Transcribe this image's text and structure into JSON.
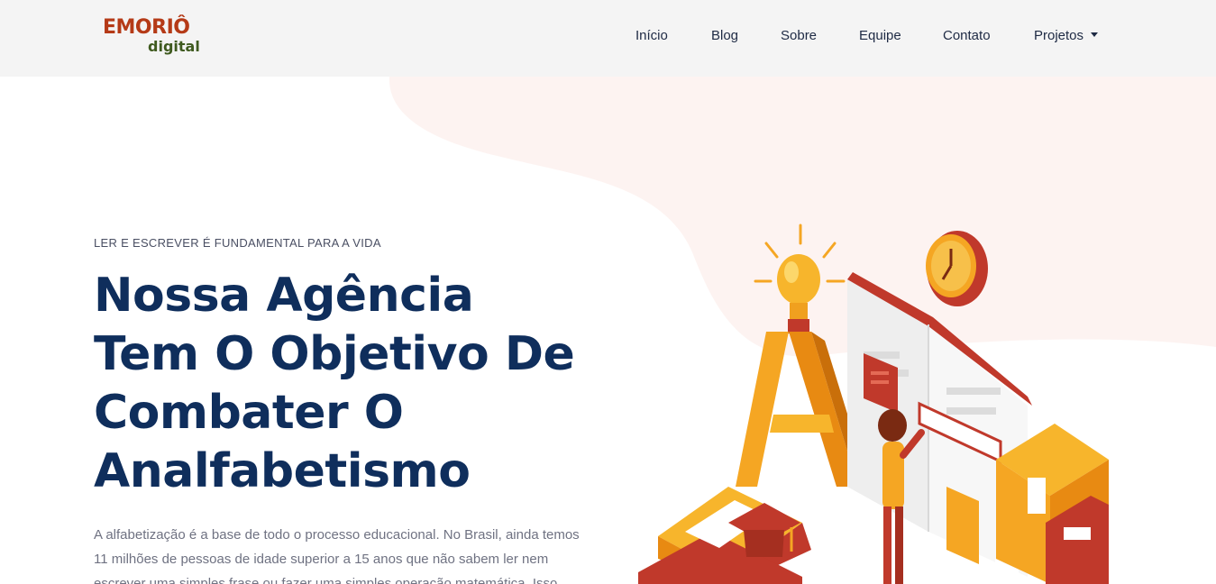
{
  "brand": {
    "logo_top": "EMORIÔ",
    "logo_bottom": "digital"
  },
  "nav": {
    "items": [
      {
        "label": "Início"
      },
      {
        "label": "Blog"
      },
      {
        "label": "Sobre"
      },
      {
        "label": "Equipe"
      },
      {
        "label": "Contato"
      },
      {
        "label": "Projetos"
      }
    ]
  },
  "hero": {
    "eyebrow": "LER E ESCREVER É FUNDAMENTAL PARA A VIDA",
    "headline_lines": [
      "Nossa Agência",
      "Tem O Objetivo De",
      "Combater O",
      "Analfabetismo"
    ],
    "body": "A alfabetização é a base de todo o processo educacional. No Brasil, ainda temos 11 milhões de pessoas de idade superior a 15 anos que não sabem ler nem escrever uma simples frase ou fazer uma simples operação matemática. Isso"
  },
  "colors": {
    "navbar_bg": "#f4f4f4",
    "headline": "#0f2e5c",
    "blob": "#fdf3f1",
    "accent_orange": "#f5a623",
    "accent_red": "#c0392b"
  }
}
